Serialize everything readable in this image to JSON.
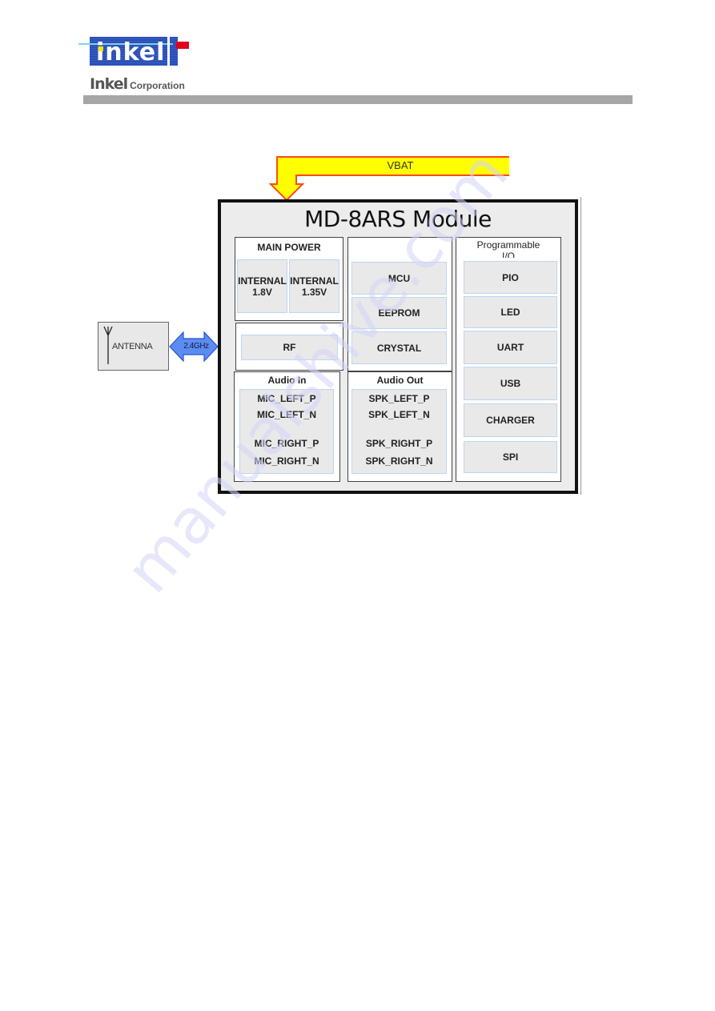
{
  "header": {
    "logo_text": "inkel",
    "company_brand": "Inkel",
    "company_suffix": "Corporation"
  },
  "diagram": {
    "power_input": {
      "label": "VBAT",
      "fill": "#ffff00",
      "stroke": "#ff4a1a"
    },
    "antenna": {
      "label": "ANTENNA",
      "link_label": "2.4GHz",
      "link_color": "#5b8df0"
    },
    "module": {
      "title": "MD-8ARS Module",
      "main_power": {
        "title": "MAIN POWER",
        "items": [
          {
            "line1": "INTERNAL",
            "line2": "1.8V"
          },
          {
            "line1": "INTERNAL",
            "line2": "1.35V"
          }
        ]
      },
      "rf": {
        "label": "RF"
      },
      "core": {
        "items": [
          "MCU",
          "EEPROM",
          "CRYSTAL"
        ]
      },
      "programmable_io": {
        "title_line1": "Programmable",
        "title_line2": "I/O",
        "items": [
          "PIO",
          "LED",
          "UART",
          "USB",
          "CHARGER",
          "SPI"
        ]
      },
      "audio_in": {
        "title": "Audio In",
        "pins": [
          "MIC_LEFT_P",
          "MIC_LEFT_N",
          "MIC_RIGHT_P",
          "MIC_RIGHT_N"
        ]
      },
      "audio_out": {
        "title": "Audio Out",
        "pins": [
          "SPK_LEFT_P",
          "SPK_LEFT_N",
          "SPK_RIGHT_P",
          "SPK_RIGHT_N"
        ]
      }
    }
  },
  "watermark": "manualshive.com"
}
